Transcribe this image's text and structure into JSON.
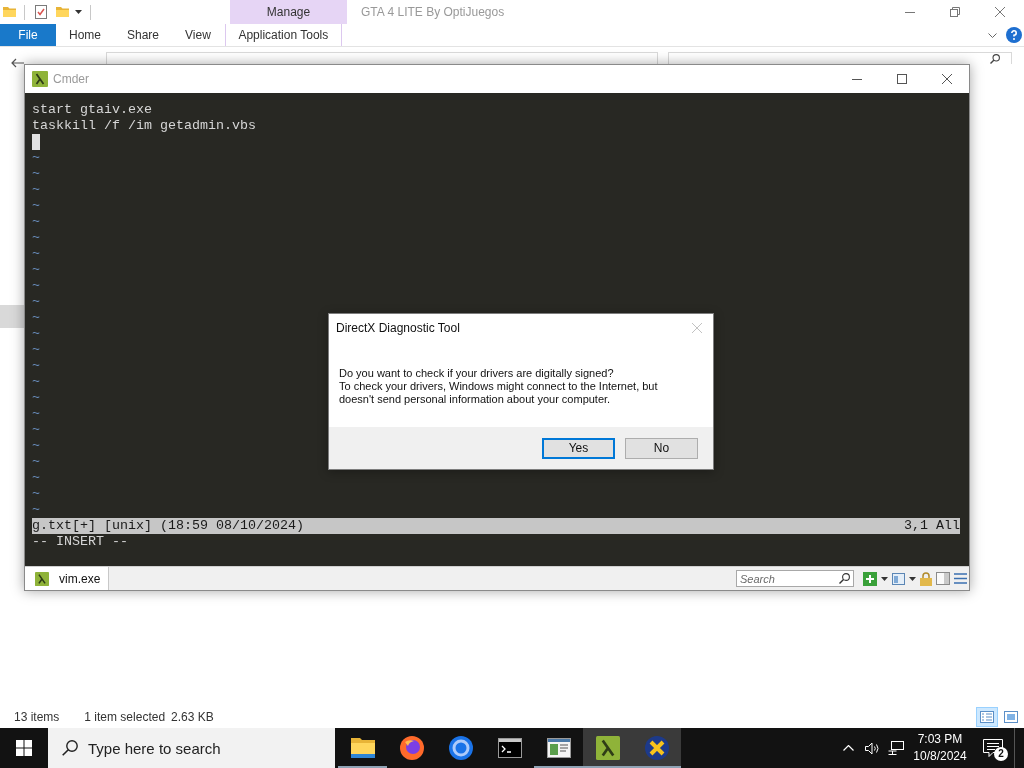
{
  "explorer": {
    "contextual_group": "Manage",
    "title": "GTA 4 LITE By OptiJuegos",
    "ribbon_tabs": [
      {
        "label": "File",
        "kind": "file",
        "selected": false
      },
      {
        "label": "Home",
        "kind": "plain",
        "selected": false
      },
      {
        "label": "Share",
        "kind": "plain",
        "selected": false
      },
      {
        "label": "View",
        "kind": "plain",
        "selected": false
      },
      {
        "label": "Application Tools",
        "kind": "contextual",
        "selected": false
      }
    ],
    "status_bar": {
      "items": "13 items",
      "selected": "1 item selected",
      "size": "2.63 KB"
    },
    "view_modes": [
      {
        "kind": "details",
        "selected": true
      },
      {
        "kind": "large_icons",
        "selected": false
      }
    ]
  },
  "cmder": {
    "title": "Cmder",
    "buffer_lines": [
      "start gtaiv.exe",
      "taskkill /f /im getadmin.vbs"
    ],
    "empty_line_markers": [
      "~",
      "~",
      "~",
      "~",
      "~",
      "~",
      "~",
      "~",
      "~",
      "~",
      "~",
      "~",
      "~",
      "~",
      "~",
      "~",
      "~",
      "~",
      "~",
      "~",
      "~",
      "~",
      "~"
    ],
    "status_line": {
      "file_info": "g.txt[+] [unix] (18:59 08/10/2024)",
      "position": "3,1 All"
    },
    "mode": "-- INSERT --",
    "tabs": [
      {
        "label": "vim.exe",
        "selected": true
      }
    ],
    "search": {
      "placeholder": "Search"
    }
  },
  "dialog": {
    "title": "DirectX Diagnostic Tool",
    "message": [
      "Do you want to check if your drivers are digitally signed?",
      "To check your drivers, Windows might connect to the Internet, but doesn't send personal information about your computer."
    ],
    "buttons": [
      {
        "label": "Yes",
        "default": true
      },
      {
        "label": "No",
        "default": false
      }
    ]
  },
  "taskbar": {
    "search": {
      "placeholder": "Type here to search"
    },
    "apps": [
      {
        "kind": "file_explorer",
        "running": true,
        "active": false
      },
      {
        "kind": "firefox",
        "running": false,
        "active": false
      },
      {
        "kind": "chrome",
        "running": false,
        "active": false
      },
      {
        "kind": "terminal",
        "running": false,
        "active": false
      },
      {
        "kind": "window",
        "running": true,
        "active": false
      },
      {
        "kind": "cmder",
        "running": true,
        "active": true
      },
      {
        "kind": "xampp",
        "running": true,
        "active": true
      }
    ],
    "clock": {
      "time": "7:03 PM",
      "date": "10/8/2024"
    },
    "notifications": {
      "count": "2"
    }
  }
}
